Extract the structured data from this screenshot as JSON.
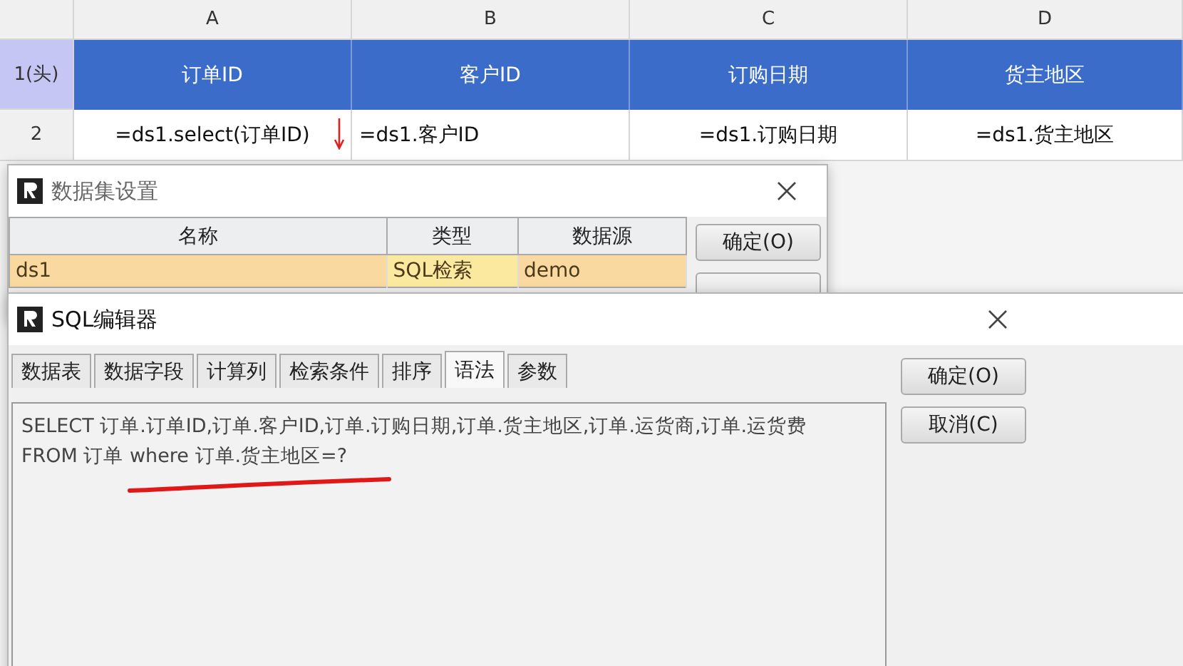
{
  "sheet": {
    "column_headers": [
      "A",
      "B",
      "C",
      "D"
    ],
    "rows": [
      {
        "row_header": "1(头)",
        "kind": "header",
        "cells": [
          "订单ID",
          "客户ID",
          "订购日期",
          "货主地区"
        ]
      },
      {
        "row_header": "2",
        "kind": "data",
        "cells": [
          "=ds1.select(订单ID)",
          "=ds1.客户ID",
          "=ds1.订购日期",
          "=ds1.货主地区"
        ],
        "expand_arrow": true
      }
    ]
  },
  "dataset_dialog": {
    "title": "数据集设置",
    "columns": [
      "名称",
      "类型",
      "数据源"
    ],
    "rows": [
      {
        "cells": [
          "ds1",
          "SQL检索",
          "demo"
        ],
        "selected": true
      }
    ],
    "buttons": [
      "确定(O)"
    ]
  },
  "sql_editor": {
    "title": "SQL编辑器",
    "tabs": [
      {
        "label": "数据表",
        "selected": false
      },
      {
        "label": "数据字段",
        "selected": false
      },
      {
        "label": "计算列",
        "selected": false
      },
      {
        "label": "检索条件",
        "selected": false
      },
      {
        "label": "排序",
        "selected": false
      },
      {
        "label": "语法",
        "selected": true
      },
      {
        "label": "参数",
        "selected": false
      }
    ],
    "sql_lines": [
      "SELECT 订单.订单ID,订单.客户ID,订单.订购日期,订单.货主地区,订单.运货商,订单.运货费",
      "FROM 订单 where 订单.货主地区=?"
    ],
    "buttons": [
      "确定(O)",
      "取消(C)"
    ]
  }
}
